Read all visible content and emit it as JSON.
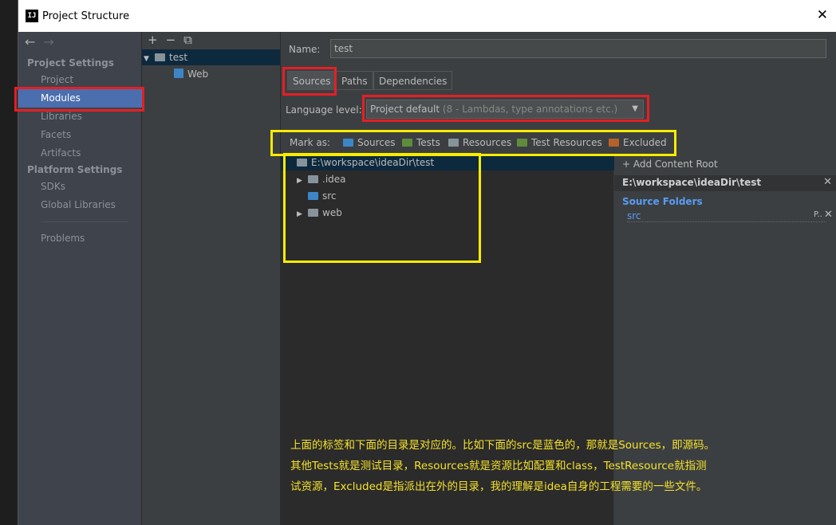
{
  "window": {
    "title": "Project Structure",
    "logo": "IJ"
  },
  "left": {
    "sections": [
      "Project Settings",
      "Platform Settings"
    ],
    "items": [
      "Project",
      "Modules",
      "Libraries",
      "Facets",
      "Artifacts"
    ],
    "platform_items": [
      "SDKs",
      "Global Libraries"
    ],
    "problems": "Problems",
    "selected": "Modules"
  },
  "modules": {
    "root": "test",
    "child": "Web"
  },
  "main": {
    "name_label": "Name:",
    "name_value": "test",
    "tabs": [
      "Sources",
      "Paths",
      "Dependencies"
    ],
    "language_label": "Language level:",
    "language_value": "Project default",
    "language_hint": "(8 - Lambdas, type annotations etc.)",
    "mark_label": "Mark as:",
    "mark_items": [
      "Sources",
      "Tests",
      "Resources",
      "Test Resources",
      "Excluded"
    ],
    "tree": {
      "root": "E:\\workspace\\ideaDir\\test",
      "children": [
        ".idea",
        "src",
        "web"
      ]
    },
    "content_root": {
      "add_label": "+ Add Content Root",
      "path": "E:\\workspace\\ideaDir\\test",
      "source_folders_label": "Source Folders",
      "source_folder": "src",
      "source_folder_action": "P.."
    }
  },
  "annotation": {
    "lines": [
      "上面的标签和下面的目录是对应的。比如下面的src是蓝色的，那就是Sources，即源码。",
      "其他Tests就是测试目录，Resources就是资源比如配置和class，TestResource就指测",
      "试资源，Excluded是指派出在外的目录，我的理解是idea自身的工程需要的一些文件。"
    ]
  },
  "colors": {
    "selection": "#4b6eaf",
    "highlight_red": "#e51f24",
    "highlight_yellow": "#f8ec00",
    "source_folder": "#589df6"
  }
}
